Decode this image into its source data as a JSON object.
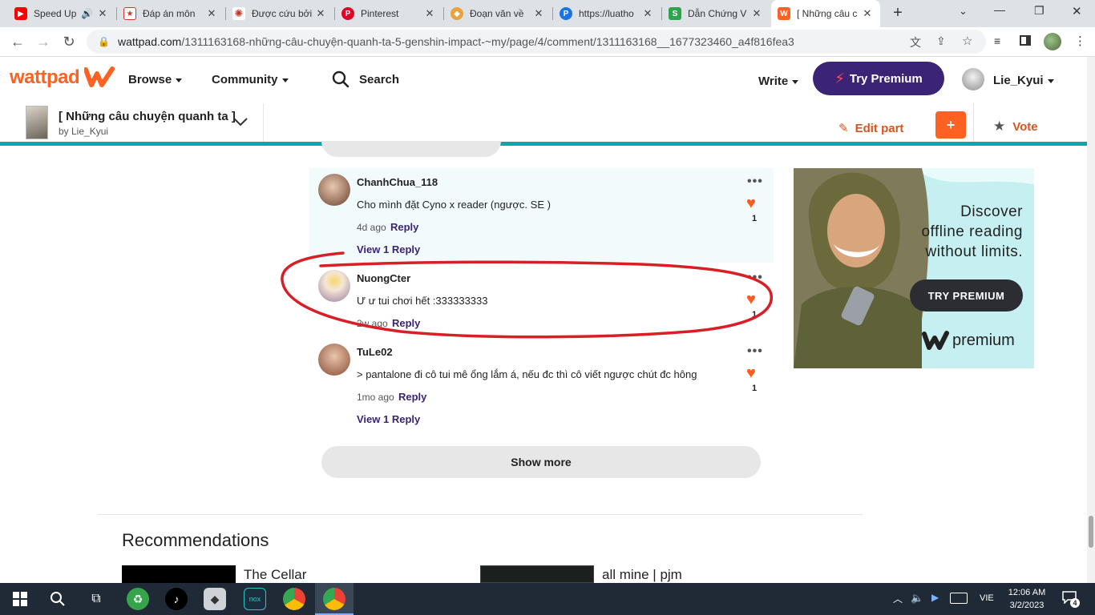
{
  "browser": {
    "tabs": [
      {
        "title": "Speed Up",
        "favicon": "youtube-icon",
        "color": "#ff0000"
      },
      {
        "title": "Đáp án môn",
        "favicon": "star-icon",
        "color": "#d93025"
      },
      {
        "title": "Được cứu bởi",
        "favicon": "fan-icon",
        "color": "#c0392b"
      },
      {
        "title": "Pinterest",
        "favicon": "pinterest-icon",
        "color": "#e60023"
      },
      {
        "title": "Đoạn văn về",
        "favicon": "book-icon",
        "color": "#e8a33d"
      },
      {
        "title": "https://luatho",
        "favicon": "law-icon",
        "color": "#1a73e8"
      },
      {
        "title": "Dẫn Chứng V",
        "favicon": "s-icon",
        "color": "#2ea44f"
      },
      {
        "title": "[ Những câu c",
        "favicon": "wattpad-icon",
        "color": "#ff6122"
      }
    ],
    "new_tab": "+",
    "url_host": "wattpad.com",
    "url_path": "/1311163168-những-câu-chuyện-quanh-ta-5-genshin-impact-~my/page/4/comment/1311163168__1677323460_a4f816fea3"
  },
  "header": {
    "logo": "wattpad",
    "browse": "Browse",
    "community": "Community",
    "search": "Search",
    "write": "Write",
    "try_premium": "Try Premium",
    "username": "Lie_Kyui"
  },
  "story": {
    "title": "[ Những câu chuyện quanh ta ]",
    "author": "by Lie_Kyui",
    "edit_part": "Edit part",
    "add": "+",
    "vote": "Vote"
  },
  "comments": [
    {
      "user": "ChanhChua_118",
      "text": "Cho mình đặt Cyno x reader (ngược. SE )",
      "time": "4d ago",
      "reply": "Reply",
      "likes": "1",
      "view_replies": "View 1 Reply"
    },
    {
      "user": "NuongCter",
      "text": "Ư ư tui chơi hết :333333333",
      "time": "2w ago",
      "reply": "Reply",
      "likes": "1",
      "view_replies": ""
    },
    {
      "user": "TuLe02",
      "text": "> pantalone đi cô tui mê ổng lắm á, nếu đc thì cô viết ngược chút đc hông",
      "time": "1mo ago",
      "reply": "Reply",
      "likes": "1",
      "view_replies": "View 1 Reply"
    }
  ],
  "show_more": "Show more",
  "ad": {
    "line1": "Discover",
    "line2": "offline reading",
    "line3": "without limits.",
    "cta": "TRY PREMIUM",
    "brand": "premium"
  },
  "recommendations": {
    "heading": "Recommendations",
    "items": [
      {
        "title": "The Cellar"
      },
      {
        "title": "all mine | pjm"
      }
    ]
  },
  "taskbar": {
    "language": "VIE",
    "time": "12:06 AM",
    "date": "3/2/2023",
    "notifications": "4"
  },
  "colors": {
    "wattpad_orange": "#ff6122",
    "premium_purple": "#3b2375",
    "teal": "#15a3a8",
    "annotation_red": "#d81f26"
  }
}
